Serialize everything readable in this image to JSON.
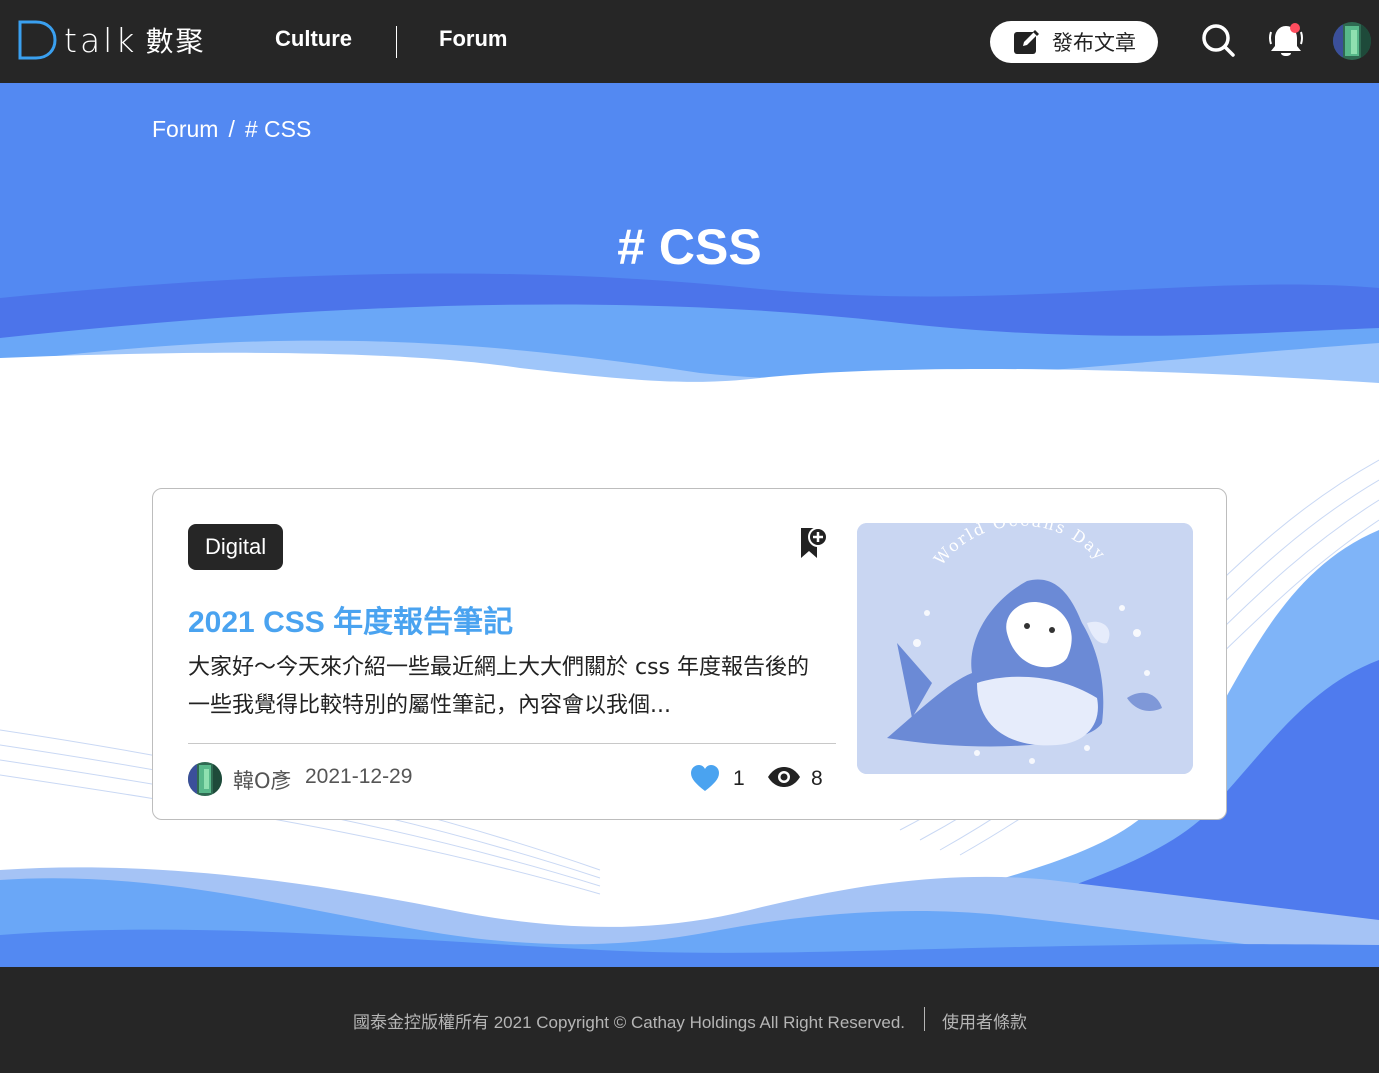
{
  "header": {
    "logo_text": "talk",
    "logo_cn": "數聚",
    "nav": [
      {
        "label": "Culture"
      },
      {
        "label": "Forum"
      }
    ],
    "publish_label": "發布文章"
  },
  "hero": {
    "breadcrumb": [
      "Forum",
      "/",
      "# CSS"
    ],
    "title": "# CSS"
  },
  "post": {
    "tag": "Digital",
    "title": "2021 CSS 年度報告筆記",
    "excerpt": "大家好～今天來介紹一些最近網上大大們關於 css 年度報告後的一些我覺得比較特別的屬性筆記，內容會以我個...",
    "author": "韓O彥",
    "date": "2021-12-29",
    "likes": "1",
    "views": "8",
    "thumb_caption": "World Oceans Day"
  },
  "footer": {
    "copyright": "國泰金控版權所有 2021 Copyright © Cathay Holdings All Right Reserved.",
    "terms": "使用者條款"
  },
  "colors": {
    "header_bg": "#262626",
    "hero_blue": "#5389f2",
    "accent_title": "#4aa3f0",
    "like_blue": "#4aa3f0"
  },
  "icons": [
    "pencil-square-icon",
    "search-icon",
    "bell-icon",
    "bookmark-plus-icon",
    "heart-icon",
    "eye-icon"
  ]
}
